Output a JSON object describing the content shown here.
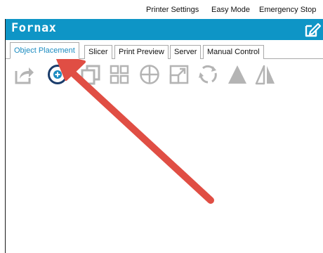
{
  "menu": {
    "printer_settings": "Printer Settings",
    "easy_mode": "Easy Mode",
    "emergency_stop": "Emergency Stop"
  },
  "app": {
    "title": "Fornax"
  },
  "tabs": [
    {
      "label": "Object Placement",
      "active": true
    },
    {
      "label": "Slicer",
      "active": false
    },
    {
      "label": "Print Preview",
      "active": false
    },
    {
      "label": "Server",
      "active": false
    },
    {
      "label": "Manual Control",
      "active": false
    }
  ],
  "toolbar": {
    "icons": [
      "share-icon",
      "add-object-icon",
      "copy-icon",
      "grid-layout-icon",
      "center-icon",
      "scale-icon",
      "rotate-icon",
      "flat-icon",
      "mirror-icon"
    ]
  },
  "colors": {
    "title_bar": "#0e95c6",
    "active_tab_text": "#1a8bc0",
    "icon_gray": "#b4b4b4",
    "add_icon": "#1a3c6b",
    "arrow": "#e04e44"
  }
}
